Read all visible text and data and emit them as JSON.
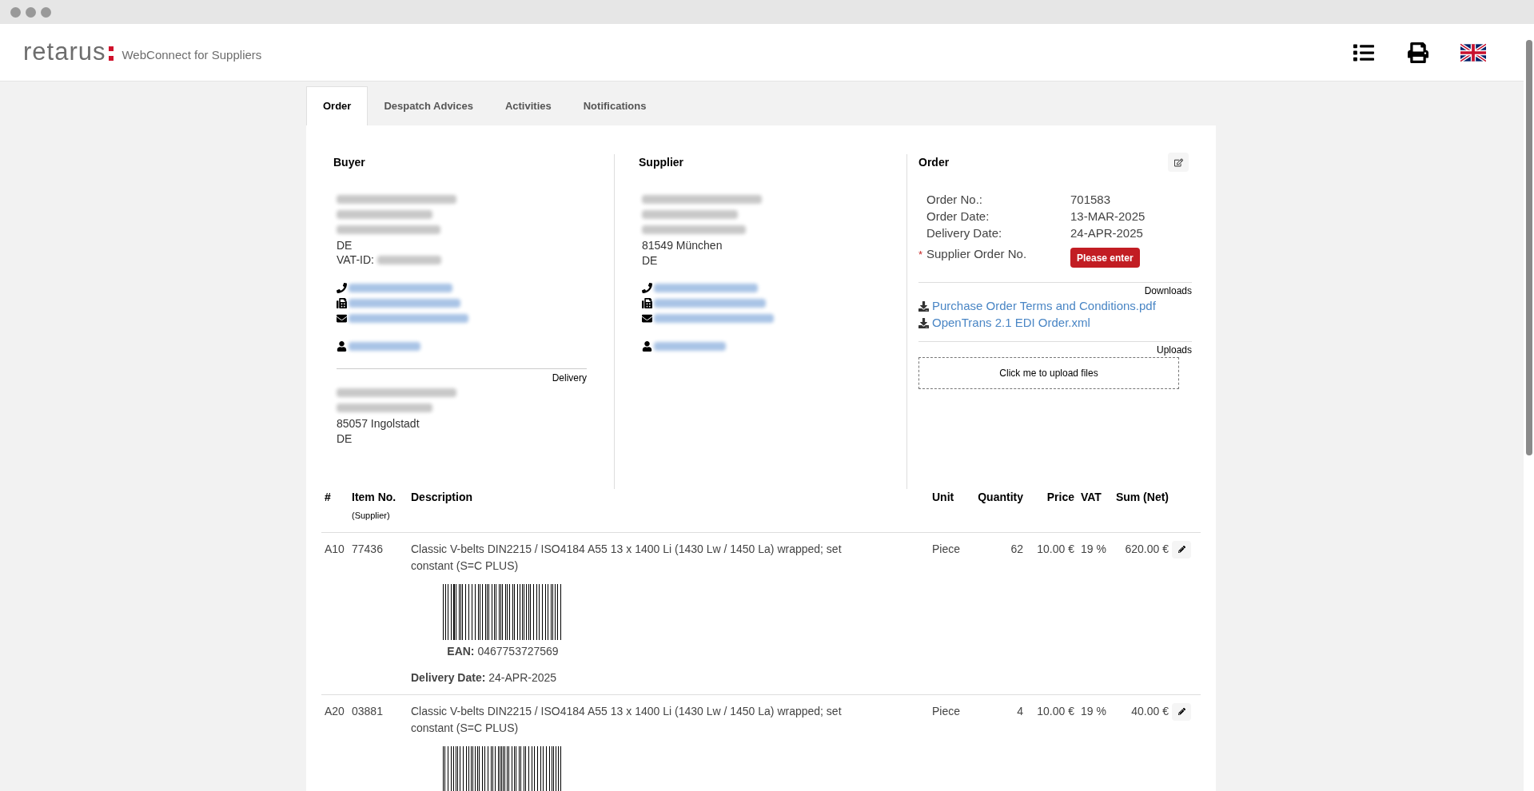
{
  "header": {
    "logo": "retarus",
    "subtitle": "WebConnect for Suppliers"
  },
  "tabs": [
    {
      "label": "Order",
      "selected": true
    },
    {
      "label": "Despatch Advices",
      "selected": false
    },
    {
      "label": "Activities",
      "selected": false
    },
    {
      "label": "Notifications",
      "selected": false
    }
  ],
  "buyer": {
    "title": "Buyer",
    "address": [
      {
        "kind": "redacted"
      },
      {
        "kind": "redacted"
      },
      {
        "kind": "redacted"
      },
      {
        "kind": "text",
        "text": "DE"
      },
      {
        "kind": "labeled",
        "text": "VAT-ID:"
      }
    ],
    "contacts": [
      {
        "kind": "phone"
      },
      {
        "kind": "fax"
      },
      {
        "kind": "email"
      }
    ],
    "person": {
      "kind": "person"
    },
    "delivery": {
      "title": "Delivery",
      "address": [
        {
          "kind": "redacted"
        },
        {
          "kind": "redacted"
        },
        {
          "kind": "text",
          "text": "85057 Ingolstadt"
        },
        {
          "kind": "text",
          "text": "DE"
        }
      ]
    }
  },
  "supplier": {
    "title": "Supplier",
    "address": [
      {
        "kind": "redacted"
      },
      {
        "kind": "redacted"
      },
      {
        "kind": "redacted"
      },
      {
        "kind": "text",
        "text": "81549 München"
      },
      {
        "kind": "text",
        "text": "DE"
      }
    ],
    "contacts": [
      {
        "kind": "phone"
      },
      {
        "kind": "fax"
      },
      {
        "kind": "email"
      }
    ],
    "person": {
      "kind": "person"
    }
  },
  "order": {
    "title": "Order",
    "fields": [
      {
        "label": "Order No.:",
        "value": "701583"
      },
      {
        "label": "Order Date:",
        "value": "13-MAR-2025"
      },
      {
        "label": "Delivery Date:",
        "value": "24-APR-2025"
      },
      {
        "label": "Supplier Order No.",
        "button": "Please enter",
        "required_mark": "*"
      }
    ],
    "downloads_title": "Downloads",
    "downloads": [
      "Purchase Order Terms and Conditions.pdf",
      "OpenTrans 2.1 EDI Order.xml"
    ],
    "uploads_title": "Uploads",
    "upload_button": "Click me to upload files"
  },
  "table": {
    "columns": [
      {
        "label": "#"
      },
      {
        "label": "Item No.",
        "sub": "(Supplier)"
      },
      {
        "label": "Description"
      },
      {
        "label": "Unit"
      },
      {
        "label": "Quantity"
      },
      {
        "label": "Price"
      },
      {
        "label": "VAT"
      },
      {
        "label": "Sum (Net)"
      }
    ],
    "rows": [
      {
        "pos": "A10",
        "item": "77436",
        "description": "Classic V-belts DIN2215 / ISO4184 A55 13 x 1400 Li (1430 Lw / 1450 La) wrapped; set constant (S=C PLUS)",
        "ean_label": "EAN:",
        "ean": "0467753727569",
        "delivery_label": "Delivery Date:",
        "delivery": "24-APR-2025",
        "unit": "Piece",
        "quantity": "62",
        "price": "10.00 €",
        "vat": "19 %",
        "sum": "620.00 €"
      },
      {
        "pos": "A20",
        "item": "03881",
        "description": "Classic V-belts DIN2215 / ISO4184 A55 13 x 1400 Li (1430 Lw / 1450 La) wrapped; set constant (S=C PLUS)",
        "unit": "Piece",
        "quantity": "4",
        "price": "10.00 €",
        "vat": "19 %",
        "sum": "40.00 €"
      }
    ]
  }
}
